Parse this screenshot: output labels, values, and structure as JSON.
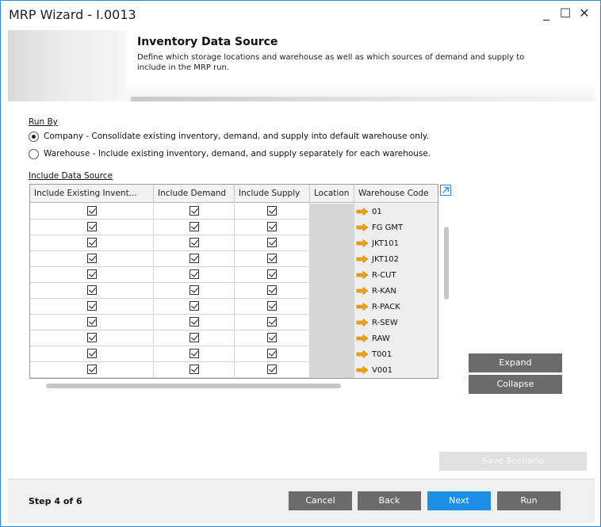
{
  "window": {
    "title": "MRP Wizard - I.0013",
    "min_glyph": "_",
    "max_glyph": "☐",
    "close_glyph": "✕"
  },
  "header": {
    "title": "Inventory Data Source",
    "description": "Define which storage locations and warehouse as well as which sources of demand and supply to include in the MRP run."
  },
  "run_by": {
    "label": "Run By",
    "options": [
      {
        "label": "Company - Consolidate existing inventory, demand, and supply into default warehouse only.",
        "selected": true
      },
      {
        "label": "Warehouse - Include existing inventory, demand, and supply separately for each warehouse.",
        "selected": false
      }
    ]
  },
  "include_data_source": {
    "label": "Include Data Source",
    "columns": [
      "Include Existing Invent...",
      "Include Demand",
      "Include Supply",
      "Location",
      "Warehouse Code"
    ],
    "rows": [
      {
        "inventory": true,
        "demand": true,
        "supply": true,
        "location": "",
        "warehouse": "01"
      },
      {
        "inventory": true,
        "demand": true,
        "supply": true,
        "location": "",
        "warehouse": "FG GMT"
      },
      {
        "inventory": true,
        "demand": true,
        "supply": true,
        "location": "",
        "warehouse": "JKT101"
      },
      {
        "inventory": true,
        "demand": true,
        "supply": true,
        "location": "",
        "warehouse": "JKT102"
      },
      {
        "inventory": true,
        "demand": true,
        "supply": true,
        "location": "",
        "warehouse": "R-CUT"
      },
      {
        "inventory": true,
        "demand": true,
        "supply": true,
        "location": "",
        "warehouse": "R-KAN"
      },
      {
        "inventory": true,
        "demand": true,
        "supply": true,
        "location": "",
        "warehouse": "R-PACK"
      },
      {
        "inventory": true,
        "demand": true,
        "supply": true,
        "location": "",
        "warehouse": "R-SEW"
      },
      {
        "inventory": true,
        "demand": true,
        "supply": true,
        "location": "",
        "warehouse": "RAW"
      },
      {
        "inventory": true,
        "demand": true,
        "supply": true,
        "location": "",
        "warehouse": "T001"
      },
      {
        "inventory": true,
        "demand": true,
        "supply": true,
        "location": "",
        "warehouse": "V001"
      }
    ]
  },
  "buttons": {
    "expand": "Expand",
    "collapse": "Collapse",
    "save_scenario": "Save Scenario",
    "cancel": "Cancel",
    "back": "Back",
    "next": "Next",
    "run": "Run"
  },
  "footer": {
    "step": "Step 4 of 6"
  },
  "colors": {
    "accent": "#1d8ee6",
    "button_gray": "#6b6b6b",
    "arrow_orange": "#f2a20c"
  },
  "icons": {
    "row_link": "orange-arrow-icon",
    "grid_expand": "expand-arrow-icon"
  }
}
